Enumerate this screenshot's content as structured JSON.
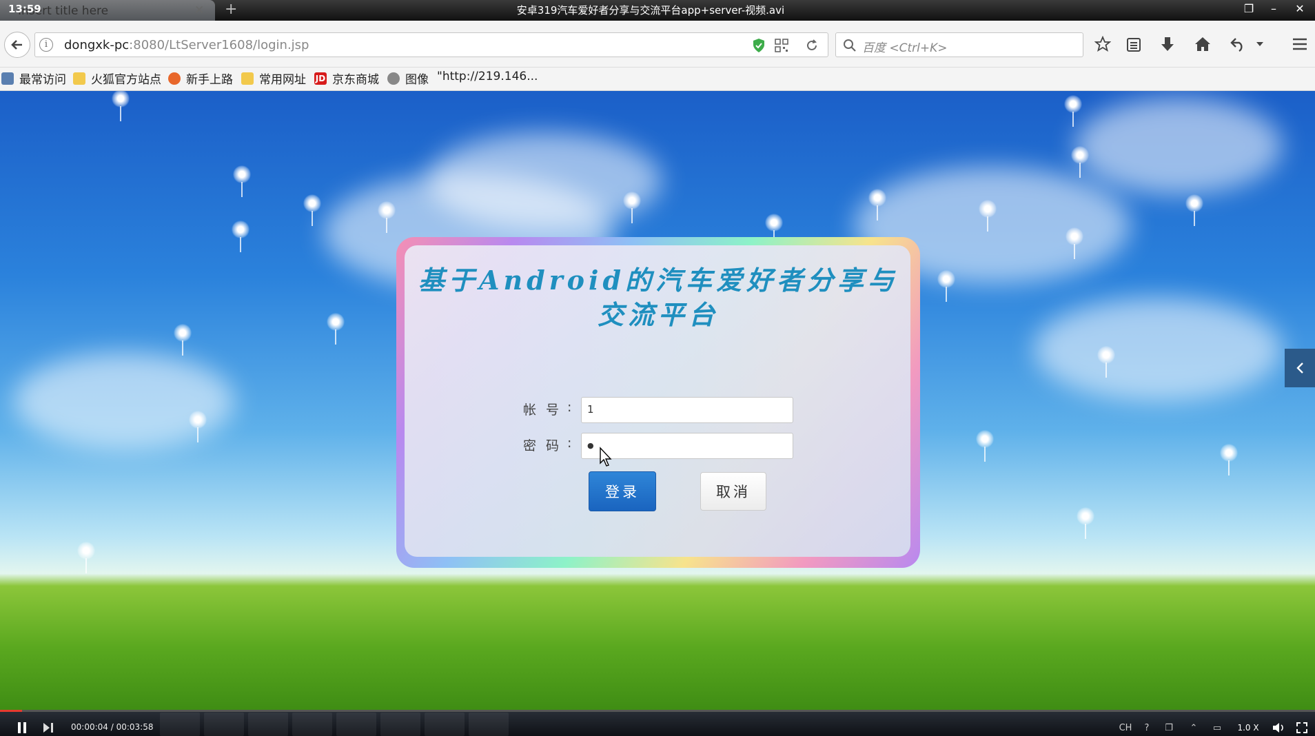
{
  "window": {
    "clock": "13:59",
    "tab_title": "Insert title here",
    "new_tab": "+",
    "video_title": "安卓319汽车爱好者分享与交流平台app+server-视频.avi"
  },
  "nav": {
    "url_host": "dongxk-pc",
    "url_rest": ":8080/LtServer1608/login.jsp",
    "search_placeholder": "百度 <Ctrl+K>"
  },
  "bookmarks": [
    {
      "label": "最常访问",
      "icon": "most-visited-icon",
      "color": "#5a7fb0"
    },
    {
      "label": "火狐官方站点",
      "icon": "folder-icon",
      "color": "#f2c94c"
    },
    {
      "label": "新手上路",
      "icon": "firefox-icon",
      "color": "#e8672b"
    },
    {
      "label": "常用网址",
      "icon": "folder-icon",
      "color": "#f2c94c"
    },
    {
      "label": "京东商城",
      "icon": "jd-icon",
      "color": "#d71c1c"
    },
    {
      "label": "图像",
      "icon": "globe-icon",
      "color": "#888888"
    },
    {
      "label": "\"http://219.146...",
      "icon": "",
      "color": ""
    }
  ],
  "login": {
    "title": "基于Android的汽车爱好者分享与交流平台",
    "account_label": "帐号",
    "password_label": "密码",
    "colon": ":",
    "account_value": "1",
    "password_value": "●",
    "login_button": "登录",
    "cancel_button": "取消"
  },
  "player": {
    "time": "00:00:04 / 00:03:58",
    "progress": 0.017,
    "speed": "1.0 X",
    "ch": "CH"
  },
  "colors": {
    "accent": "#1a64bf",
    "title_text": "#1f8fbf",
    "progress": "#e63a2e"
  }
}
